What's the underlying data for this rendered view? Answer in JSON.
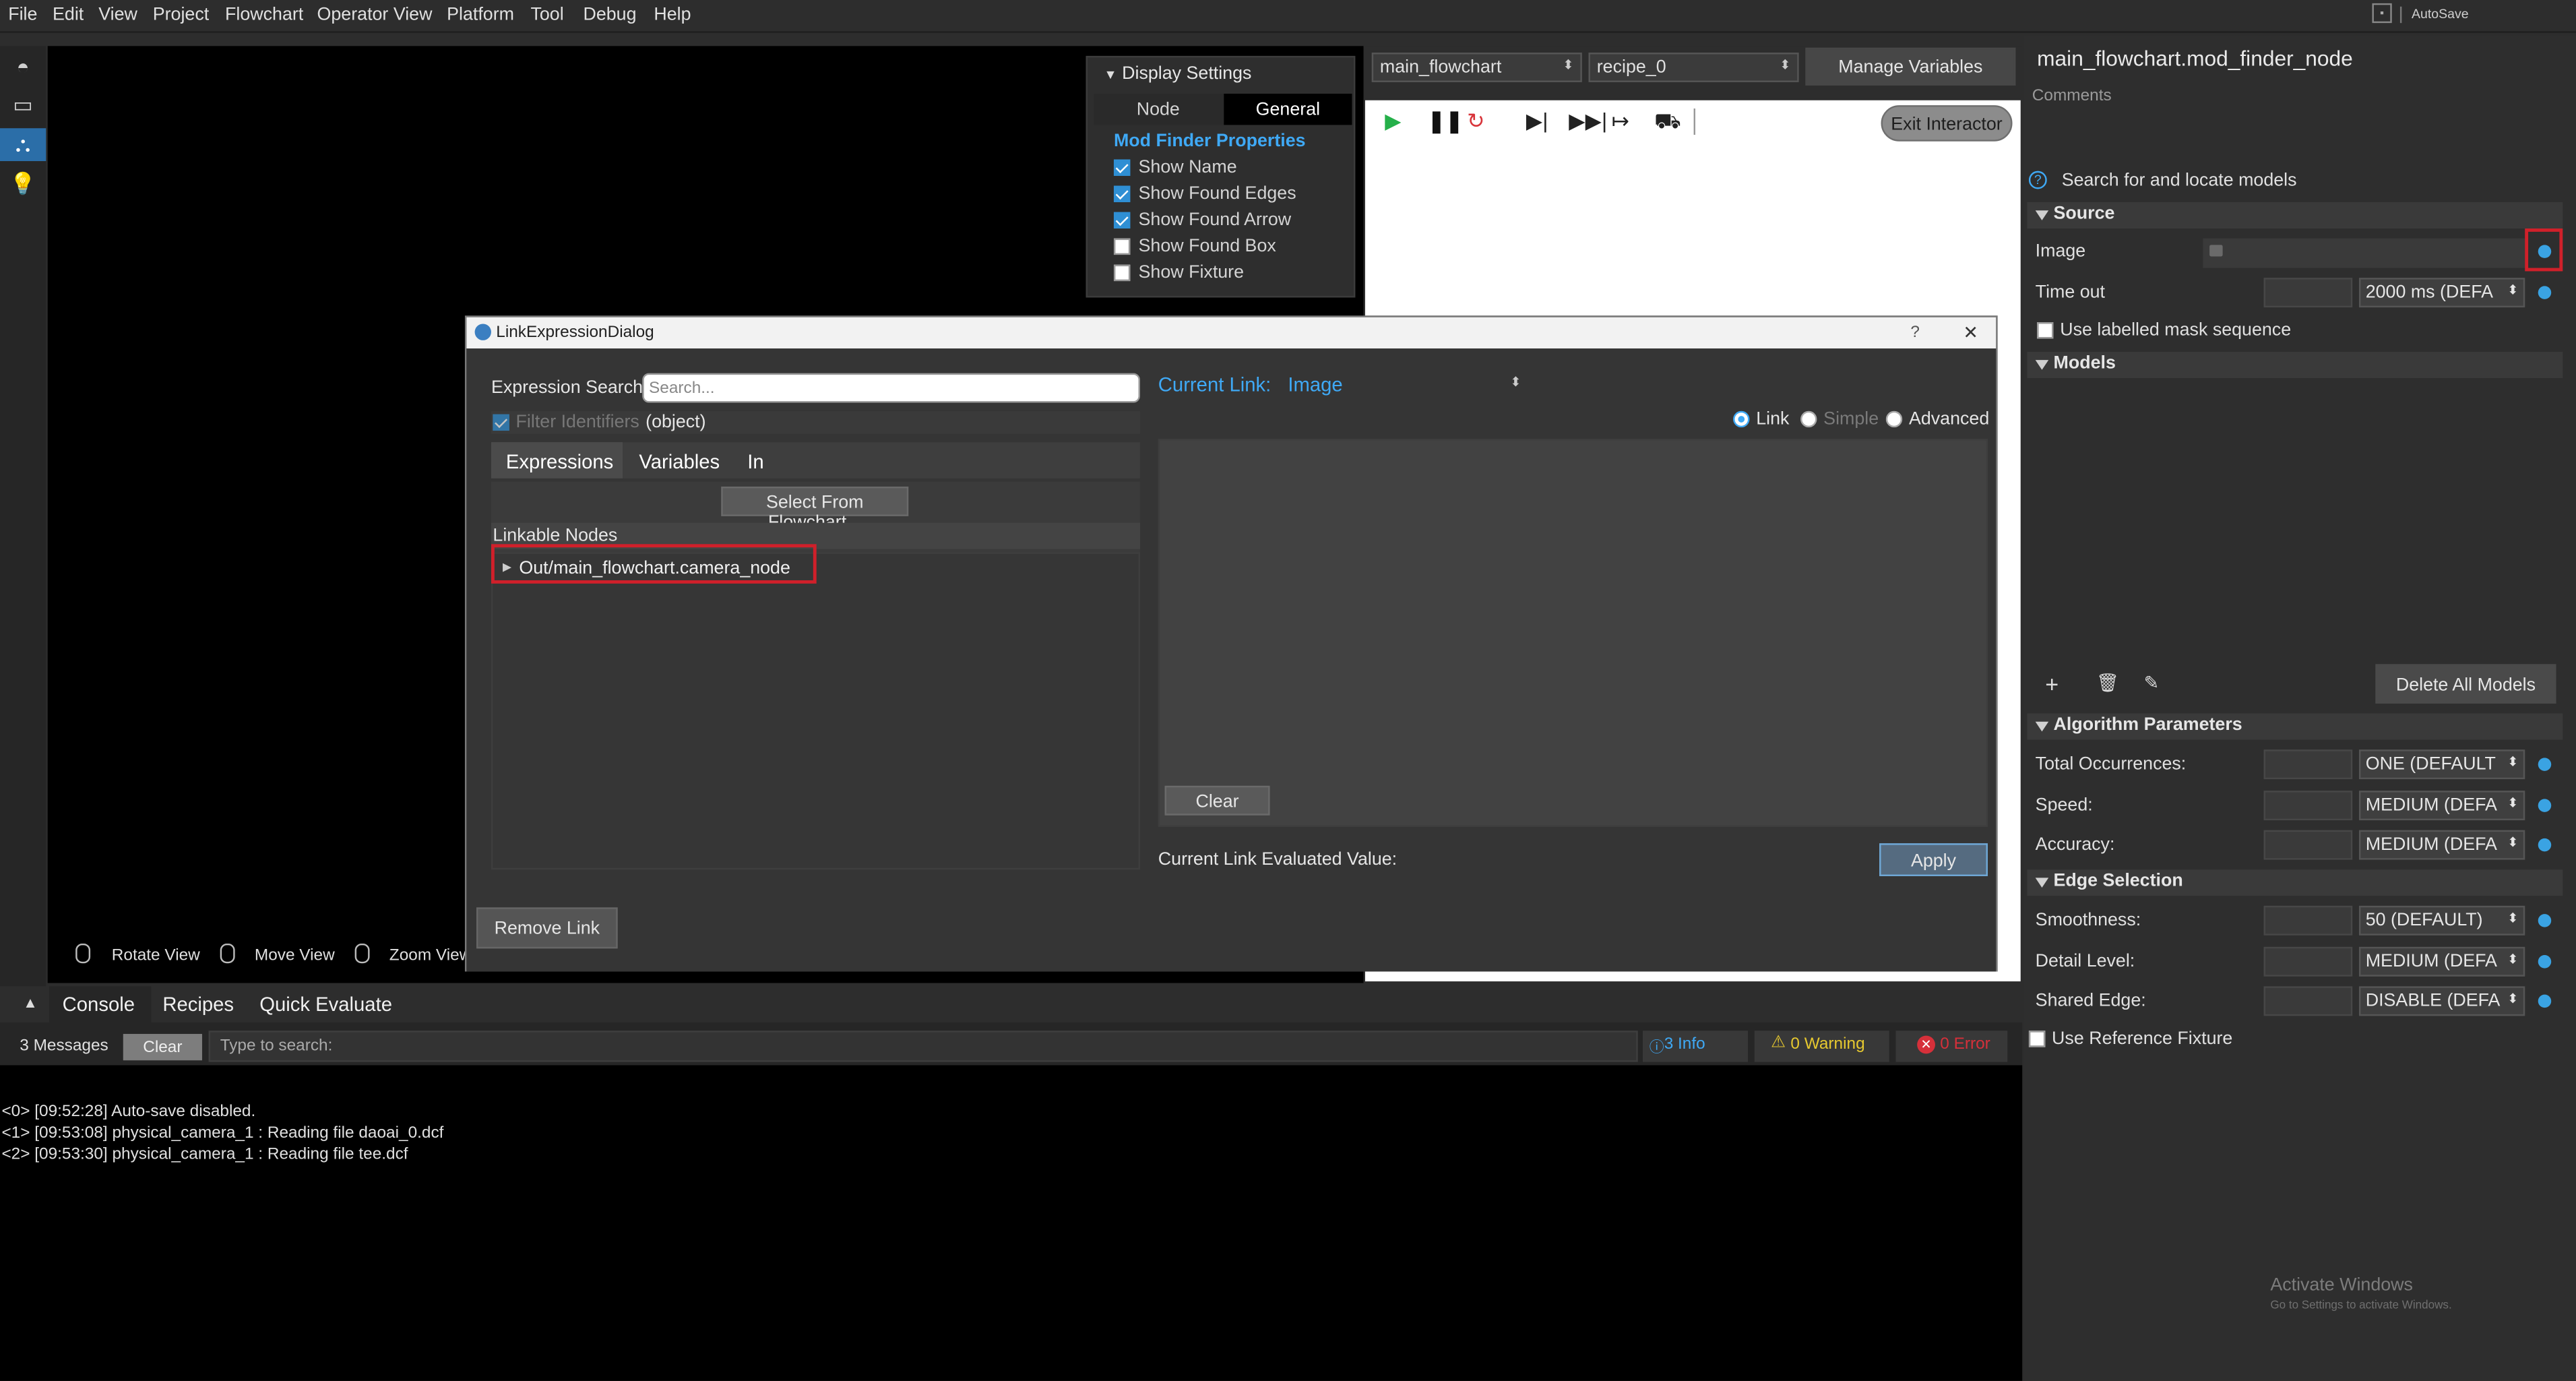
{
  "menu": [
    "File",
    "Edit",
    "View",
    "Project",
    "Flowchart",
    "Operator View",
    "Platform",
    "Tool",
    "Debug",
    "Help"
  ],
  "autosave_label": "AutoSave",
  "viewport": {
    "hints": [
      "Rotate View",
      "Move View",
      "Zoom View"
    ]
  },
  "display_settings": {
    "title": "Display Settings",
    "tabs": [
      "Node",
      "General"
    ],
    "section": "Mod Finder Properties",
    "options": [
      {
        "label": "Show Name",
        "checked": true
      },
      {
        "label": "Show Found Edges",
        "checked": true
      },
      {
        "label": "Show Found Arrow",
        "checked": true
      },
      {
        "label": "Show Found Box",
        "checked": false
      },
      {
        "label": "Show Fixture",
        "checked": false
      }
    ]
  },
  "flowchart": {
    "flowchart_select": "main_flowchart",
    "recipe_select": "recipe_0",
    "manage_variables": "Manage Variables",
    "exit_interactor": "Exit Interactor"
  },
  "node": {
    "title": "main_flowchart.mod_finder_node",
    "comments_label": "Comments",
    "description": "Search for and locate models",
    "source_header": "Source",
    "image_label": "Image",
    "timeout_label": "Time out",
    "timeout_value": "2000 ms (DEFA",
    "mask_sequence": "Use labelled mask sequence",
    "models_header": "Models",
    "delete_all_models": "Delete All Models",
    "algorithm_header": "Algorithm Parameters",
    "total_occurrences_label": "Total Occurrences:",
    "total_occurrences_value": "ONE (DEFAULT",
    "speed_label": "Speed:",
    "speed_value": "MEDIUM (DEFA",
    "accuracy_label": "Accuracy:",
    "accuracy_value": "MEDIUM (DEFA",
    "edge_header": "Edge Selection",
    "smoothness_label": "Smoothness:",
    "smoothness_value": "50 (DEFAULT)",
    "detail_label": "Detail Level:",
    "detail_value": "MEDIUM (DEFA",
    "shared_edge_label": "Shared Edge:",
    "shared_edge_value": "DISABLE (DEFA",
    "reference_fixture": "Use Reference Fixture",
    "watermark_title": "Activate Windows",
    "watermark_sub": "Go to Settings to activate Windows."
  },
  "dialog": {
    "title": "LinkExpressionDialog",
    "help": "?",
    "close": "✕",
    "search_label": "Expression Search:",
    "search_placeholder": "Search...",
    "filter_label": "Filter Identifiers",
    "filter_type": "(object)",
    "tabs": [
      "Expressions",
      "Variables",
      "In"
    ],
    "select_from_flowchart": "Select From Flowchart...",
    "linkable_header": "Linkable Nodes",
    "tree_item": "Out/main_flowchart.camera_node",
    "current_link_label": "Current Link:",
    "current_link_value": "Image",
    "modes": [
      {
        "label": "Link",
        "selected": true
      },
      {
        "label": "Simple",
        "selected": false
      },
      {
        "label": "Advanced",
        "selected": false
      }
    ],
    "clear": "Clear",
    "evaluated_label": "Current Link Evaluated Value:",
    "apply": "Apply",
    "remove_link": "Remove Link"
  },
  "console": {
    "tabs": [
      "Console",
      "Recipes",
      "Quick Evaluate"
    ],
    "message_count": "3 Messages",
    "clear": "Clear",
    "search_placeholder": "Type to search:",
    "info": "3 Info",
    "warning": "0 Warning",
    "error": "0 Error",
    "lines": [
      "<0> [09:52:28] Auto-save disabled.",
      "<1> [09:53:08] physical_camera_1 : Reading file daoai_0.dcf",
      "<2> [09:53:30] physical_camera_1 : Reading file tee.dcf"
    ]
  }
}
